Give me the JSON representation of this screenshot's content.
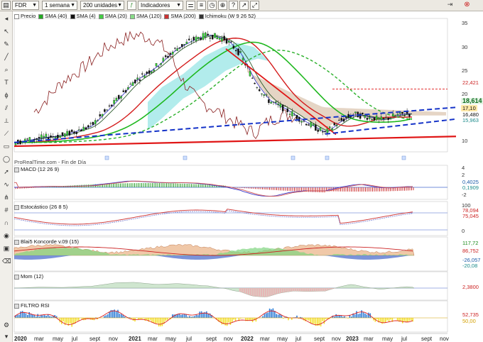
{
  "toolbar": {
    "symbol": "FDR",
    "timeframe": "1 semana",
    "units": "200 unidades",
    "indicators_label": "Indicadores"
  },
  "legend": [
    {
      "label": "Precio",
      "color": "#ffffff"
    },
    {
      "label": "SMA (40)",
      "color": "#22aa22"
    },
    {
      "label": "SMA (4)",
      "color": "#111111"
    },
    {
      "label": "SMA (20)",
      "color": "#44cc44"
    },
    {
      "label": "SMA (120)",
      "color": "#88dd88"
    },
    {
      "label": "SMA (200)",
      "color": "#cc3333"
    },
    {
      "label": "Ichimoku (W 9 26 52)",
      "color": "#333333"
    }
  ],
  "source_label": "ProRealTime.com - Fin de Día",
  "price_axis": {
    "ticks": [
      "35",
      "30",
      "25",
      "20",
      "15",
      "10"
    ],
    "tags": [
      {
        "text": "22,421",
        "color": "#cc2222",
        "bg": "#ffffff"
      },
      {
        "text": "18,614",
        "color": "#0b6b1e",
        "bg": "#e6f5e6"
      },
      {
        "text": "17,10",
        "color": "#111111",
        "bg": "#ffe9a8"
      },
      {
        "text": "16,480",
        "color": "#111111",
        "bg": "#ffffff"
      },
      {
        "text": "15,963",
        "color": "#1a8a8a",
        "bg": "#ffffff"
      }
    ]
  },
  "panels": {
    "macd": {
      "title": "MACD (12 26 9)",
      "ticks": [
        "4",
        "2",
        "0,4025",
        "0,1909",
        "-2"
      ]
    },
    "stoch": {
      "title": "Estocástico (26 8 5)",
      "ticks": [
        "100",
        "78,094",
        "75,045",
        "0"
      ]
    },
    "koncorde": {
      "title": "Blai5 Koncorde v.09 (15)",
      "ticks": [
        "117,72",
        "86,752",
        "-26,057",
        "-20,08"
      ]
    },
    "mom": {
      "title": "Mom (12)",
      "ticks": [
        "2,3800"
      ]
    },
    "rsi": {
      "title": "FILTRO RSI",
      "ticks": [
        "52,735",
        "50,00"
      ]
    }
  },
  "x_axis": [
    "2020",
    "mar",
    "may",
    "jul",
    "sept",
    "nov",
    "2021",
    "mar",
    "may",
    "jul",
    "sept",
    "nov",
    "2022",
    "mar",
    "may",
    "jul",
    "sept",
    "nov",
    "2023",
    "mar",
    "may",
    "jul",
    "sept",
    "nov"
  ],
  "colors": {
    "trend_blue": "#1533c8",
    "trend_red": "#e01616",
    "sma_green": "#1fb81f",
    "sma_red": "#d41c1c",
    "cloud_green": "#9fe7e7",
    "cloud_brown": "#dcc7b1"
  }
}
